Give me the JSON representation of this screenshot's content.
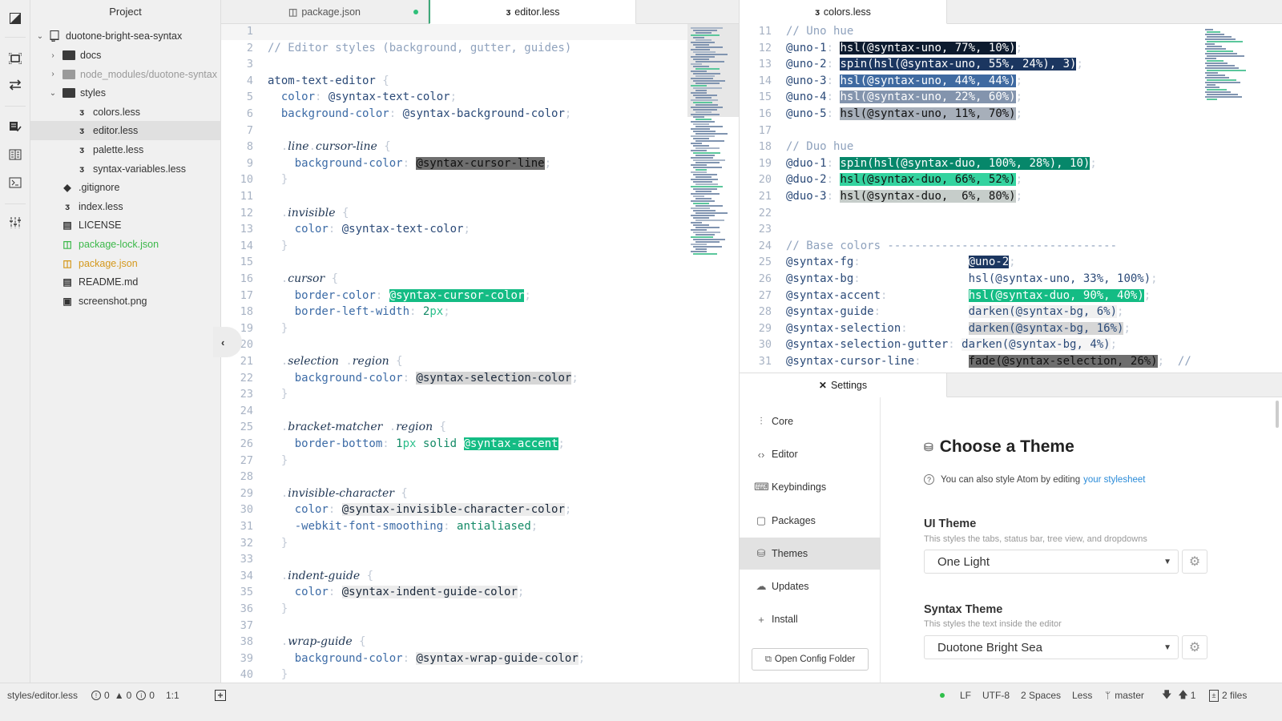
{
  "dock": {
    "icons": [
      "editor-toggle-icon",
      "fullscreen-icon",
      "swap-icon",
      "todo-icon",
      "book-icon",
      "terminal-icon",
      "sliders-icon"
    ]
  },
  "tree": {
    "title": "Project",
    "root": "duotone-bright-sea-syntax",
    "items": [
      {
        "label": "docs",
        "type": "folder",
        "state": "collapsed"
      },
      {
        "label": "node_modules/duotone-syntax",
        "type": "folder",
        "state": "collapsed",
        "muted": true
      },
      {
        "label": "styles",
        "type": "folder",
        "state": "expanded"
      },
      {
        "label": "colors.less",
        "type": "less"
      },
      {
        "label": "editor.less",
        "type": "less",
        "selected": true
      },
      {
        "label": "palette.less",
        "type": "less"
      },
      {
        "label": "syntax-variables.less",
        "type": "less"
      },
      {
        "label": ".gitignore",
        "type": "git"
      },
      {
        "label": "index.less",
        "type": "less"
      },
      {
        "label": "LICENSE",
        "type": "book"
      },
      {
        "label": "package-lock.json",
        "type": "npm",
        "status": "added"
      },
      {
        "label": "package.json",
        "type": "npm",
        "status": "modified"
      },
      {
        "label": "README.md",
        "type": "book"
      },
      {
        "label": "screenshot.png",
        "type": "image"
      }
    ]
  },
  "left_pane": {
    "tabs": [
      {
        "label": "package.json",
        "modified": true,
        "active": false
      },
      {
        "label": "editor.less",
        "active": true
      }
    ]
  },
  "right_pane": {
    "tabs": [
      {
        "label": "colors.less",
        "active": true
      }
    ]
  },
  "editor_left": {
    "lines": [
      {
        "n": "1",
        "html": ""
      },
      {
        "n": "2",
        "html": "<span class='cm'>// Editor styles (background, gutter, guides)</span>"
      },
      {
        "n": "3",
        "html": ""
      },
      {
        "n": "4",
        "html": "atom-text-editor <span class='pn'>{</span>"
      },
      {
        "n": "5",
        "html": "  <span class='prop'>color</span><span class='pn'>:</span> @syntax-text-color<span class='pn'>;</span>"
      },
      {
        "n": "6",
        "html": "  <span class='prop'>background-color</span><span class='pn'>:</span> @syntax-background-color<span class='pn'>;</span>"
      },
      {
        "n": "7",
        "html": ""
      },
      {
        "n": "8",
        "html": "  <span class='pn'>.</span><span class='sel-it'>line</span><span class='pn'>.</span><span class='sel-it'>cursor-line</span> <span class='pn'>{</span>"
      },
      {
        "n": "9",
        "html": "    <span class='prop'>background-color</span><span class='pn'>:</span> <span class='hl-dark'>@syntax-cursor-line</span><span class='pn'>;</span>"
      },
      {
        "n": "10",
        "html": "  <span class='pn'>}</span>"
      },
      {
        "n": "11",
        "html": ""
      },
      {
        "n": "12",
        "html": "  <span class='pn'>.</span><span class='sel-it'>invisible</span> <span class='pn'>{</span>"
      },
      {
        "n": "13",
        "html": "    <span class='prop'>color</span><span class='pn'>:</span> @syntax-text-color<span class='pn'>;</span>"
      },
      {
        "n": "14",
        "html": "  <span class='pn'>}</span>"
      },
      {
        "n": "15",
        "html": ""
      },
      {
        "n": "16",
        "html": "  <span class='pn'>.</span><span class='sel-it'>cursor</span> <span class='pn'>{</span>"
      },
      {
        "n": "17",
        "html": "    <span class='prop'>border-color</span><span class='pn'>:</span> <span class='hl-acc'>@syntax-cursor-color</span><span class='pn'>;</span>"
      },
      {
        "n": "18",
        "html": "    <span class='prop'>border-left-width</span><span class='pn'>:</span> <span class='kw'>2</span><span class='num'>px</span><span class='pn'>;</span>"
      },
      {
        "n": "19",
        "html": "  <span class='pn'>}</span>"
      },
      {
        "n": "20",
        "html": ""
      },
      {
        "n": "21",
        "html": "  <span class='pn'>.</span><span class='sel-it'>selection</span> <span class='pn'>.</span><span class='sel-it'>region</span> <span class='pn'>{</span>"
      },
      {
        "n": "22",
        "html": "    <span class='prop'>background-color</span><span class='pn'>:</span> <span class='hl-grey'>@syntax-selection-color</span><span class='pn'>;</span>"
      },
      {
        "n": "23",
        "html": "  <span class='pn'>}</span>"
      },
      {
        "n": "24",
        "html": ""
      },
      {
        "n": "25",
        "html": "  <span class='pn'>.</span><span class='sel-it'>bracket-matcher</span> <span class='pn'>.</span><span class='sel-it'>region</span> <span class='pn'>{</span>"
      },
      {
        "n": "26",
        "html": "    <span class='prop'>border-bottom</span><span class='pn'>:</span> <span class='kw'>1</span><span class='num'>px</span> <span class='kw'>solid</span> <span class='hl-acc'>@syntax-accent</span><span class='pn'>;</span>"
      },
      {
        "n": "27",
        "html": "  <span class='pn'>}</span>"
      },
      {
        "n": "28",
        "html": ""
      },
      {
        "n": "29",
        "html": "  <span class='pn'>.</span><span class='sel-it'>invisible-character</span> <span class='pn'>{</span>"
      },
      {
        "n": "30",
        "html": "    <span class='prop'>color</span><span class='pn'>:</span> <span class='hl-light'>@syntax-invisible-character-color</span><span class='pn'>;</span>"
      },
      {
        "n": "31",
        "html": "    <span class='prop'>-webkit-font-smoothing</span><span class='pn'>:</span> <span class='kw'>antialiased</span><span class='pn'>;</span>"
      },
      {
        "n": "32",
        "html": "  <span class='pn'>}</span>"
      },
      {
        "n": "33",
        "html": ""
      },
      {
        "n": "34",
        "html": "  <span class='pn'>.</span><span class='sel-it'>indent-guide</span> <span class='pn'>{</span>"
      },
      {
        "n": "35",
        "html": "    <span class='prop'>color</span><span class='pn'>:</span> <span class='hl-light'>@syntax-indent-guide-color</span><span class='pn'>;</span>"
      },
      {
        "n": "36",
        "html": "  <span class='pn'>}</span>"
      },
      {
        "n": "37",
        "html": ""
      },
      {
        "n": "38",
        "html": "  <span class='pn'>.</span><span class='sel-it'>wrap-guide</span> <span class='pn'>{</span>"
      },
      {
        "n": "39",
        "html": "    <span class='prop'>background-color</span><span class='pn'>:</span> <span class='hl-light'>@syntax-wrap-guide-color</span><span class='pn'>;</span>"
      },
      {
        "n": "40",
        "html": "  <span class='pn'>}</span>"
      }
    ]
  },
  "editor_right": {
    "lines": [
      {
        "n": "11",
        "html": "<span class='cm'>// Uno hue</span>"
      },
      {
        "n": "12",
        "html": "@uno-1<span class='pn'>:</span> <span style='background:#0c1a2e;color:#fff'>hsl(@syntax-uno, 77%, 10%)</span><span class='pn'>;</span>"
      },
      {
        "n": "13",
        "html": "@uno-2<span class='pn'>:</span> <span style='background:#1b3660;color:#fff'>spin(hsl(@syntax-uno, 55%, 24%), 3)</span><span class='pn'>;</span>"
      },
      {
        "n": "14",
        "html": "@uno-3<span class='pn'>:</span> <span style='background:#3f6aa1;color:#fff'>hsl(@syntax-uno, 44%, 44%)</span><span class='pn'>;</span>"
      },
      {
        "n": "15",
        "html": "@uno-4<span class='pn'>:</span> <span style='background:#8394ad;color:#fff'>hsl(@syntax-uno, 22%, 60%)</span><span class='pn'>;</span>"
      },
      {
        "n": "16",
        "html": "@uno-5<span class='pn'>:</span> <span style='background:#a7afba;color:#111'>hsl(@syntax-uno, 11%, 70%)</span><span class='pn'>;</span>"
      },
      {
        "n": "17",
        "html": ""
      },
      {
        "n": "18",
        "html": "<span class='cm'>// Duo hue</span>"
      },
      {
        "n": "19",
        "html": "@duo-1<span class='pn'>:</span> <span style='background:#06876a;color:#fff'>spin(hsl(@syntax-duo, 100%, 28%), 10)</span><span class='pn'>;</span>"
      },
      {
        "n": "20",
        "html": "@duo-2<span class='pn'>:</span> <span style='background:#34d39f;color:#111'>hsl(@syntax-duo, 66%, 52%)</span><span class='pn'>;</span>"
      },
      {
        "n": "21",
        "html": "@duo-3<span class='pn'>:</span> <span style='background:#c6cdca;color:#111'>hsl(@syntax-duo,  6%, 80%)</span><span class='pn'>;</span>"
      },
      {
        "n": "22",
        "html": ""
      },
      {
        "n": "23",
        "html": ""
      },
      {
        "n": "24",
        "html": "<span class='cm'>// Base colors ----------------------------------</span>"
      },
      {
        "n": "25",
        "html": "@syntax-fg<span class='pn'>:</span>                <span style='background:#1b3660;color:#fff'>@uno-2</span><span class='pn'>;</span>"
      },
      {
        "n": "26",
        "html": "@syntax-bg<span class='pn'>:</span>                hsl(@syntax-uno, 33%, 100%)<span class='pn'>;</span>"
      },
      {
        "n": "27",
        "html": "@syntax-accent<span class='pn'>:</span>            <span style='background:#14bc84;color:#fff'>hsl(@syntax-duo, 90%, 40%)</span><span class='pn'>;</span>"
      },
      {
        "n": "28",
        "html": "@syntax-guide<span class='pn'>:</span>             <span style='background:#f0f0f0'>darken(@syntax-bg, 6%)</span><span class='pn'>;</span>"
      },
      {
        "n": "29",
        "html": "@syntax-selection<span class='pn'>:</span>         <span style='background:#d6d6d6'>darken(@syntax-bg, 16%)</span><span class='pn'>;</span>"
      },
      {
        "n": "30",
        "html": "@syntax-selection-gutter<span class='pn'>:</span> <span style='background:#f5f5f5'>darken(@syntax-bg, 4%)</span><span class='pn'>;</span>"
      },
      {
        "n": "31",
        "html": "@syntax-cursor-line<span class='pn'>:</span>       <span class='hl-dark'>fade(@syntax-selection, 26%)</span><span class='pn'>;</span>  <span class='cm'>//</span>"
      }
    ]
  },
  "settings": {
    "tab_label": "Settings",
    "nav": [
      {
        "label": "Core",
        "icon": "sliders-icon"
      },
      {
        "label": "Editor",
        "icon": "code-icon"
      },
      {
        "label": "Keybindings",
        "icon": "keyboard-icon"
      },
      {
        "label": "Packages",
        "icon": "package-icon"
      },
      {
        "label": "Themes",
        "icon": "paintcan-icon",
        "active": true
      },
      {
        "label": "Updates",
        "icon": "cloud-download-icon"
      },
      {
        "label": "Install",
        "icon": "plus-icon"
      }
    ],
    "open_config_label": "Open Config Folder",
    "heading": "Choose a Theme",
    "hint_text": "You can also style Atom by editing",
    "hint_link": "your stylesheet",
    "ui_theme": {
      "title": "UI Theme",
      "description": "This styles the tabs, status bar, tree view, and dropdowns",
      "value": "One Light"
    },
    "syntax_theme": {
      "title": "Syntax Theme",
      "description": "This styles the text inside the editor",
      "value": "Duotone Bright Sea"
    }
  },
  "status": {
    "file_path": "styles/editor.less",
    "errors": "0",
    "warnings": "0",
    "infos": "0",
    "cursor": "1:1",
    "line_ending": "LF",
    "encoding": "UTF-8",
    "indent": "2 Spaces",
    "grammar": "Less",
    "branch": "master",
    "ahead": "1",
    "changed_files": "2 files"
  }
}
